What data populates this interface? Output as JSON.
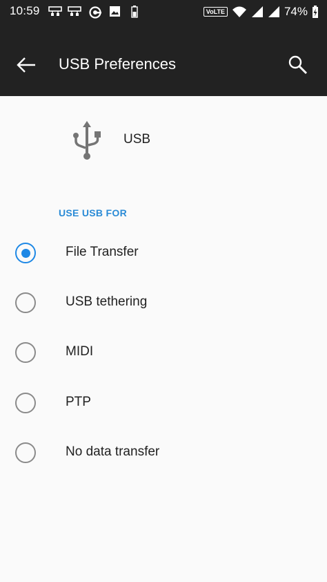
{
  "status_bar": {
    "time": "10:59",
    "network_badge": "VoLTE",
    "battery_percent": "74%",
    "icons": [
      "network-icon",
      "network-icon",
      "vpn-key-icon",
      "image-icon",
      "battery-saver-icon",
      "wifi-icon",
      "signal-icon",
      "signal-icon",
      "battery-charging-icon"
    ]
  },
  "toolbar": {
    "title": "USB Preferences",
    "back_icon": "arrow-left-icon",
    "search_icon": "search-icon"
  },
  "usb": {
    "label": "USB",
    "icon": "usb-icon"
  },
  "section": {
    "header": "USE USB FOR"
  },
  "options": [
    {
      "label": "File Transfer",
      "selected": true
    },
    {
      "label": "USB tethering",
      "selected": false
    },
    {
      "label": "MIDI",
      "selected": false
    },
    {
      "label": "PTP",
      "selected": false
    },
    {
      "label": "No data transfer",
      "selected": false
    }
  ],
  "colors": {
    "toolbar_bg": "#222222",
    "accent": "#1e88e5",
    "section_header": "#2a8bd6",
    "background": "#fafafa"
  }
}
